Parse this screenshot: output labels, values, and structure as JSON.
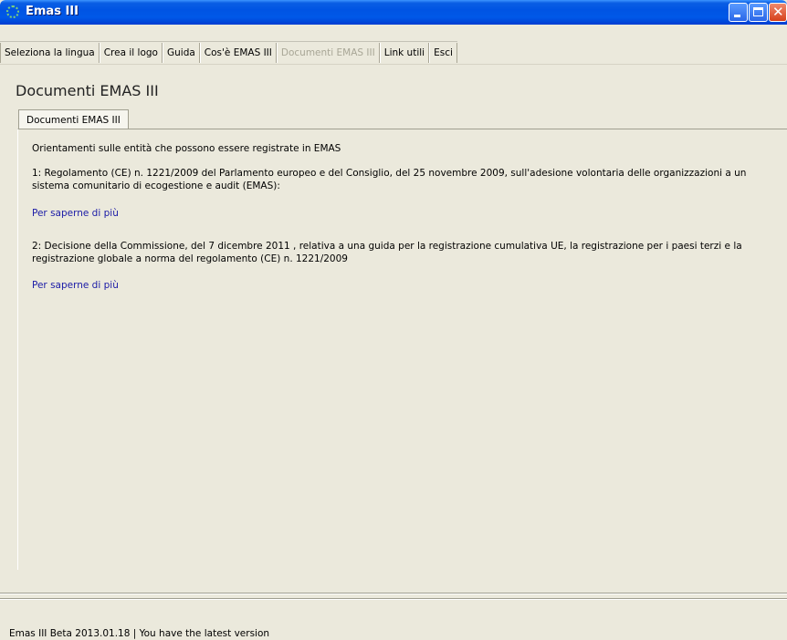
{
  "window": {
    "title": "Emas III"
  },
  "menu": {
    "items": [
      {
        "label": "Seleziona la lingua",
        "disabled": false
      },
      {
        "label": "Crea il logo",
        "disabled": false
      },
      {
        "label": "Guida",
        "disabled": false
      },
      {
        "label": "Cos'è EMAS III",
        "disabled": false
      },
      {
        "label": "Documenti EMAS III",
        "disabled": true
      },
      {
        "label": "Link utili",
        "disabled": false
      },
      {
        "label": "Esci",
        "disabled": false
      }
    ]
  },
  "page": {
    "title": "Documenti EMAS III"
  },
  "tabs": [
    {
      "label": "Documenti EMAS III",
      "active": true
    }
  ],
  "content": {
    "intro": "Orientamenti sulle entità che possono essere registrate in EMAS",
    "item1": "1: Regolamento (CE) n. 1221/2009 del Parlamento europeo e del Consiglio, del 25 novembre 2009, sull'adesione volontaria delle organizzazioni a un sistema comunitario di ecogestione e audit (EMAS):",
    "link1": "Per saperne di più",
    "item2": "2: Decisione della Commissione, del 7 dicembre 2011 , relativa a una guida per la registrazione cumulativa UE, la registrazione per i paesi terzi e la registrazione globale a norma del regolamento (CE) n. 1221/2009",
    "link2": "Per saperne di più"
  },
  "status": {
    "text": "Emas III Beta 2013.01.18  |  You have the latest version"
  },
  "icons": {
    "app": "app-icon",
    "minimize": "minimize-icon",
    "maximize": "maximize-icon",
    "close": "close-icon"
  },
  "colors": {
    "titlebar": "#0054e3",
    "background": "#ebe9dc",
    "link": "#1a1aa6",
    "disabled_text": "#a8a696"
  }
}
